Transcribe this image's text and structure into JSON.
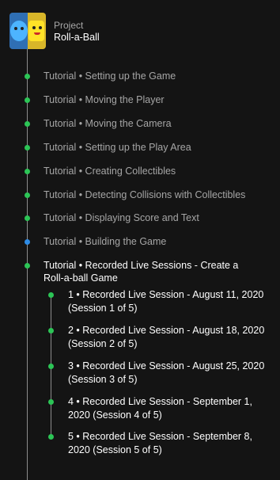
{
  "project": {
    "label": "Project",
    "title": "Roll-a-Ball"
  },
  "tutorials": [
    {
      "label": "Tutorial • Setting up the Game",
      "status": "complete"
    },
    {
      "label": "Tutorial • Moving the Player",
      "status": "complete"
    },
    {
      "label": "Tutorial • Moving the Camera",
      "status": "complete"
    },
    {
      "label": "Tutorial • Setting up the Play Area",
      "status": "complete"
    },
    {
      "label": "Tutorial • Creating Collectibles",
      "status": "complete"
    },
    {
      "label": "Tutorial • Detecting Collisions with Collectibles",
      "status": "complete"
    },
    {
      "label": "Tutorial • Displaying Score and Text",
      "status": "complete"
    },
    {
      "label": "Tutorial • Building the Game",
      "status": "current"
    },
    {
      "label": "Tutorial • Recorded Live Sessions - Create a Roll-a-ball Game",
      "status": "complete"
    }
  ],
  "sessions": [
    {
      "label": "1 • Recorded Live Session - August 11, 2020 (Session 1 of 5)"
    },
    {
      "label": "2 • Recorded Live Session - August 18, 2020 (Session 2 of 5)"
    },
    {
      "label": "3 • Recorded Live Session - August 25, 2020 (Session 3 of 5)"
    },
    {
      "label": "4 • Recorded Live Session - September 1, 2020 (Session 4 of 5)"
    },
    {
      "label": "5 • Recorded Live Session - September 8, 2020 (Session 5 of 5)"
    }
  ],
  "colors": {
    "complete": "#2cc556",
    "current": "#2e8ce6",
    "background": "#141414"
  }
}
